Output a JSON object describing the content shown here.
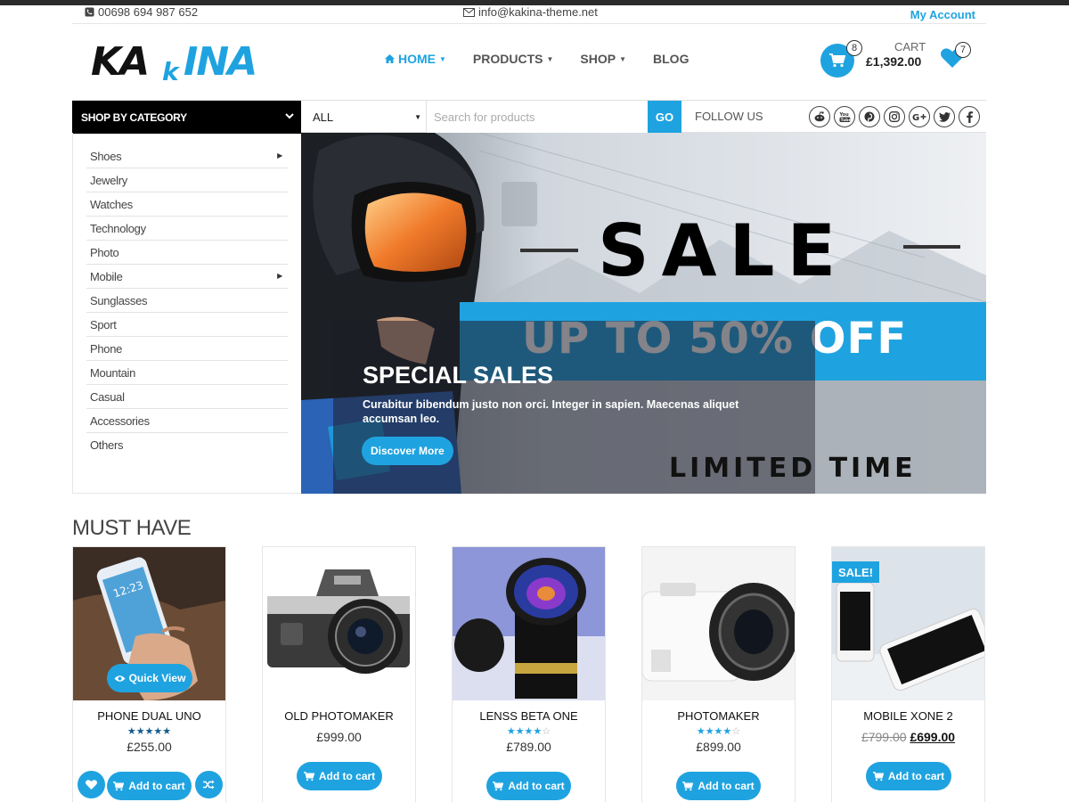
{
  "topbar": {
    "phone": "00698 694 987 652",
    "email": "info@kakina-theme.net",
    "account": "My Account"
  },
  "logo": {
    "text": "KAkINA"
  },
  "nav": [
    {
      "label": "HOME",
      "active": true,
      "dropdown": true
    },
    {
      "label": "PRODUCTS",
      "active": false,
      "dropdown": true
    },
    {
      "label": "SHOP",
      "active": false,
      "dropdown": true
    },
    {
      "label": "BLOG",
      "active": false,
      "dropdown": false
    }
  ],
  "cart": {
    "label": "CART",
    "total": "£1,392.00",
    "count": "8"
  },
  "wishlist": {
    "count": "7"
  },
  "catbar": {
    "shop_by_category": "SHOP BY CATEGORY",
    "select_value": "ALL",
    "search_placeholder": "Search for products",
    "go": "GO",
    "follow": "FOLLOW US",
    "socials": [
      "reddit-icon",
      "youtube-icon",
      "pinterest-icon",
      "instagram-icon",
      "google-plus-icon",
      "twitter-icon",
      "facebook-icon"
    ]
  },
  "categories": [
    {
      "label": "Shoes",
      "submenu": true
    },
    {
      "label": "Jewelry",
      "submenu": false
    },
    {
      "label": "Watches",
      "submenu": false
    },
    {
      "label": "Technology",
      "submenu": false
    },
    {
      "label": "Photo",
      "submenu": false
    },
    {
      "label": "Mobile",
      "submenu": true
    },
    {
      "label": "Sunglasses",
      "submenu": false
    },
    {
      "label": "Sport",
      "submenu": false
    },
    {
      "label": "Phone",
      "submenu": false
    },
    {
      "label": "Mountain",
      "submenu": false
    },
    {
      "label": "Casual",
      "submenu": false
    },
    {
      "label": "Accessories",
      "submenu": false
    },
    {
      "label": "Others",
      "submenu": false
    }
  ],
  "hero": {
    "sale": "SALE",
    "up_to": "UP TO 50% OFF",
    "limited": "LIMITED TIME",
    "title": "SPECIAL SALES",
    "description": "Curabitur bibendum justo non orci. Integer in sapien. Maecenas aliquet accumsan leo.",
    "button": "Discover More"
  },
  "section_title": "MUST HAVE",
  "products": [
    {
      "name": "PHONE DUAL UNO",
      "price": "£255.00",
      "stars": 5,
      "add": "Add to cart",
      "quick_view": "Quick View"
    },
    {
      "name": "OLD PHOTOMAKER",
      "price": "£999.00",
      "stars": 0,
      "add": "Add to cart"
    },
    {
      "name": "LENSS BETA ONE",
      "price": "£789.00",
      "stars": 4,
      "add": "Add to cart"
    },
    {
      "name": "PHOTOMAKER",
      "price": "£899.00",
      "stars": 4,
      "add": "Add to cart"
    },
    {
      "name": "MOBILE XONE 2",
      "old_price": "£799.00",
      "price": "£699.00",
      "stars": 0,
      "add": "Add to cart",
      "badge": "SALE!"
    }
  ],
  "colors": {
    "accent": "#1fa3e0",
    "dark": "#000000"
  }
}
